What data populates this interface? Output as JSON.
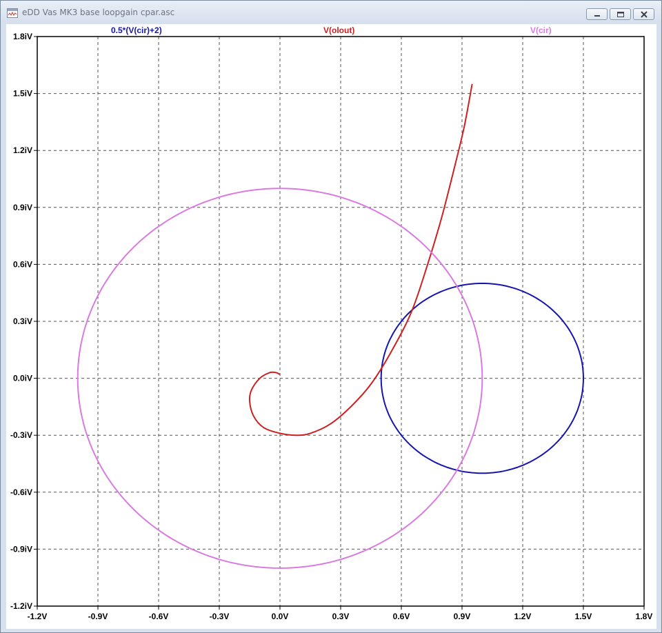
{
  "window": {
    "title": "eDD Vas MK3 base loopgain cpar.asc",
    "app_icon": "waveform-icon",
    "minimize_icon": "minimize-icon",
    "maximize_icon": "maximize-icon",
    "close_icon": "close-icon"
  },
  "trace_labels": [
    {
      "text": "0.5*(V(cir)+2)",
      "color": "#1515b0"
    },
    {
      "text": "V(olout)",
      "color": "#cc1f1f"
    },
    {
      "text": "V(cir)",
      "color": "#d97ae0"
    }
  ],
  "chart_data": {
    "type": "line",
    "xlim": [
      -1.2,
      1.8
    ],
    "ylim": [
      -1.2,
      1.8
    ],
    "x_ticks": [
      "-1.2V",
      "-0.9V",
      "-0.6V",
      "-0.3V",
      "0.0V",
      "0.3V",
      "0.6V",
      "0.9V",
      "1.2V",
      "1.5V",
      "1.8V"
    ],
    "y_ticks": [
      "1.8iV",
      "1.5iV",
      "1.2iV",
      "0.9iV",
      "0.6iV",
      "0.3iV",
      "0.0iV",
      "-0.3iV",
      "-0.6iV",
      "-0.9iV",
      "-1.2iV"
    ],
    "grid": true,
    "grid_style": "dashed",
    "series": [
      {
        "name": "0.5*(V(cir)+2)",
        "color": "#1515b0",
        "shape": "circle",
        "center": [
          1.0,
          0.0
        ],
        "radius": 0.5
      },
      {
        "name": "V(olout)",
        "color": "#cc1f1f",
        "points": [
          [
            0.0,
            0.02
          ],
          [
            -0.02,
            0.03
          ],
          [
            -0.05,
            0.03
          ],
          [
            -0.1,
            0.0
          ],
          [
            -0.14,
            -0.06
          ],
          [
            -0.15,
            -0.12
          ],
          [
            -0.13,
            -0.2
          ],
          [
            -0.08,
            -0.26
          ],
          [
            0.0,
            -0.29
          ],
          [
            0.08,
            -0.3
          ],
          [
            0.15,
            -0.29
          ],
          [
            0.25,
            -0.24
          ],
          [
            0.35,
            -0.15
          ],
          [
            0.45,
            -0.03
          ],
          [
            0.55,
            0.14
          ],
          [
            0.65,
            0.35
          ],
          [
            0.73,
            0.6
          ],
          [
            0.8,
            0.85
          ],
          [
            0.86,
            1.1
          ],
          [
            0.91,
            1.32
          ],
          [
            0.95,
            1.55
          ]
        ]
      },
      {
        "name": "V(cir)",
        "color": "#d97ae0",
        "shape": "circle",
        "center": [
          0.0,
          0.0
        ],
        "radius": 1.0
      }
    ]
  }
}
